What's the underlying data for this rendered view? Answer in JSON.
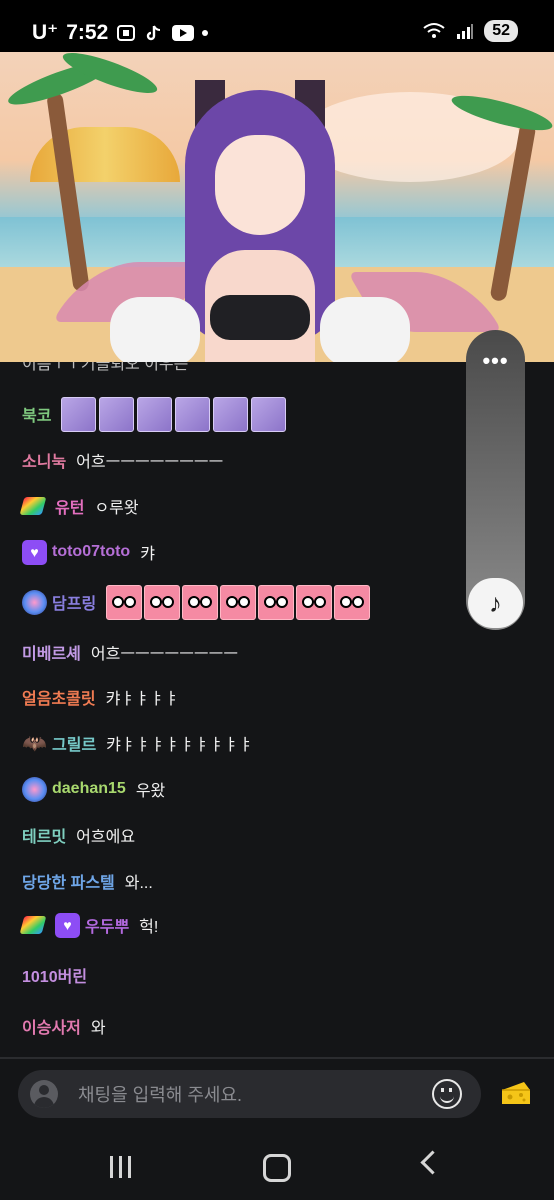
{
  "status_bar": {
    "carrier": "U⁺",
    "time": "7:52",
    "battery": "52"
  },
  "chat": {
    "partial_top_message": "이름ㅜㅜ기들뢰오 이우뜬",
    "messages": [
      {
        "nick": "북코",
        "nick_color": "#7fc97f",
        "text": "",
        "badges": [],
        "emote": "purple",
        "emote_count": 6
      },
      {
        "nick": "소니눅",
        "nick_color": "#e07aa0",
        "text": "어흐ㅡㅡㅡㅡㅡㅡㅡㅡ",
        "badges": []
      },
      {
        "nick": "유턴",
        "nick_color": "#e36fbf",
        "text": "ㅇ루왓",
        "badges": [
          "rainbow"
        ]
      },
      {
        "nick": "toto07toto",
        "nick_color": "#b56fd6",
        "text": "캬",
        "badges": [
          "heart"
        ]
      },
      {
        "nick": "담프링",
        "nick_color": "#8a7fe0",
        "text": "",
        "badges": [
          "orb"
        ],
        "emote": "pink",
        "emote_count": 7
      },
      {
        "nick": "미베르셰",
        "nick_color": "#c39be6",
        "text": "어흐ㅡㅡㅡㅡㅡㅡㅡㅡ",
        "badges": []
      },
      {
        "nick": "얼음초콜릿",
        "nick_color": "#f07b52",
        "text": "캬ㅑㅑㅑㅑ",
        "badges": []
      },
      {
        "nick": "그릴르",
        "nick_color": "#76c9c9",
        "text": "캬ㅑㅑㅑㅑㅑㅑㅑㅑㅑ",
        "badges": [
          "bat"
        ]
      },
      {
        "nick": "daehan15",
        "nick_color": "#a8d86e",
        "text": "우왔",
        "badges": [
          "orb"
        ]
      },
      {
        "nick": "테르밋",
        "nick_color": "#7fd0c0",
        "text": "어흐에요",
        "badges": []
      },
      {
        "nick": "당당한 파스텔",
        "nick_color": "#6fa6e8",
        "text": "와...",
        "badges": []
      },
      {
        "nick": "우두뿌",
        "nick_color": "#b46ae0",
        "text": "헉!",
        "badges": [
          "rainbow",
          "heart"
        ]
      },
      {
        "nick": "1010버린",
        "nick_color": "#c48fe0",
        "text": "",
        "badges": []
      },
      {
        "nick": "이승사저",
        "nick_color": "#e27ab0",
        "text": "와",
        "badges": []
      }
    ]
  },
  "music_panel": {
    "more_label": "•••",
    "music_icon": "♪"
  },
  "input": {
    "placeholder": "채팅을 입력해 주세요."
  },
  "icons": {
    "emoji": "smile-icon",
    "cheese": "cheese-icon"
  }
}
